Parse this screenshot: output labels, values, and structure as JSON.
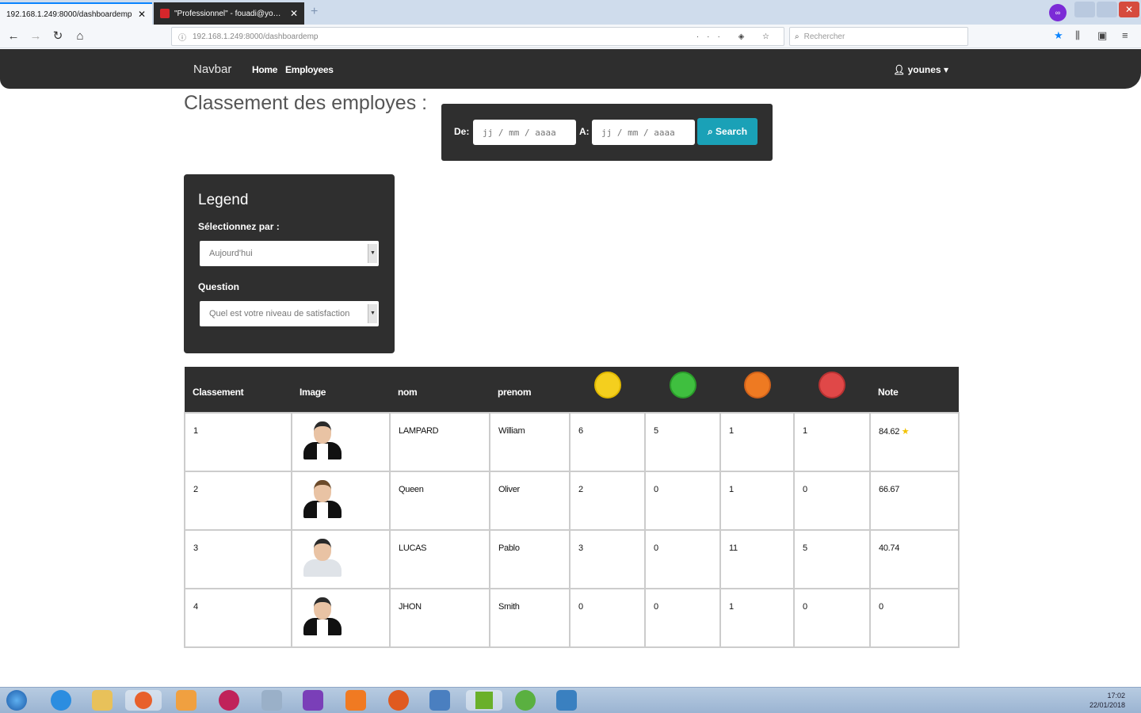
{
  "browser": {
    "tabs": [
      {
        "title": "192.168.1.249:8000/dashboardemp",
        "active": true
      },
      {
        "title": "\"Professionnel\" - fouadi@yousse…",
        "active": false
      }
    ],
    "url": "192.168.1.249:8000/dashboardemp",
    "search_placeholder": "Rechercher"
  },
  "navbar": {
    "brand": "Navbar",
    "links": [
      "Home",
      "Employees"
    ],
    "user": "younes"
  },
  "page": {
    "title": "Classement des employes :"
  },
  "date_filter": {
    "from_label": "De:",
    "to_label": "A:",
    "from_placeholder": "jj / mm / aaaa",
    "to_placeholder": "jj / mm / aaaa",
    "search_label": "Search"
  },
  "legend": {
    "title": "Legend",
    "select_by_label": "Sélectionnez par :",
    "select_by_value": "Aujourd'hui",
    "question_label": "Question",
    "question_value": "Quel est votre niveau de satisfaction"
  },
  "table": {
    "headers": [
      "Classement",
      "Image",
      "nom",
      "prenom",
      "",
      "",
      "",
      "",
      "Note"
    ],
    "emoji_colors": {
      "yellow": "#f4cf1e",
      "green": "#3fbf3f",
      "orange": "#ee7a22",
      "red": "#e04848"
    },
    "rows": [
      {
        "rank": "1",
        "nom": "LAMPARD",
        "prenom": "William",
        "c1": "6",
        "c2": "5",
        "c3": "1",
        "c4": "1",
        "note": "84.62"
      },
      {
        "rank": "2",
        "nom": "Queen",
        "prenom": "Oliver",
        "c1": "2",
        "c2": "0",
        "c3": "1",
        "c4": "0",
        "note": "66.67"
      },
      {
        "rank": "3",
        "nom": "LUCAS",
        "prenom": "Pablo",
        "c1": "3",
        "c2": "0",
        "c3": "11",
        "c4": "5",
        "note": "40.74"
      },
      {
        "rank": "4",
        "nom": "JHON",
        "prenom": "Smith",
        "c1": "0",
        "c2": "0",
        "c3": "1",
        "c4": "0",
        "note": "0"
      }
    ]
  },
  "taskbar": {
    "time": "17:02",
    "date": "22/01/2018"
  }
}
